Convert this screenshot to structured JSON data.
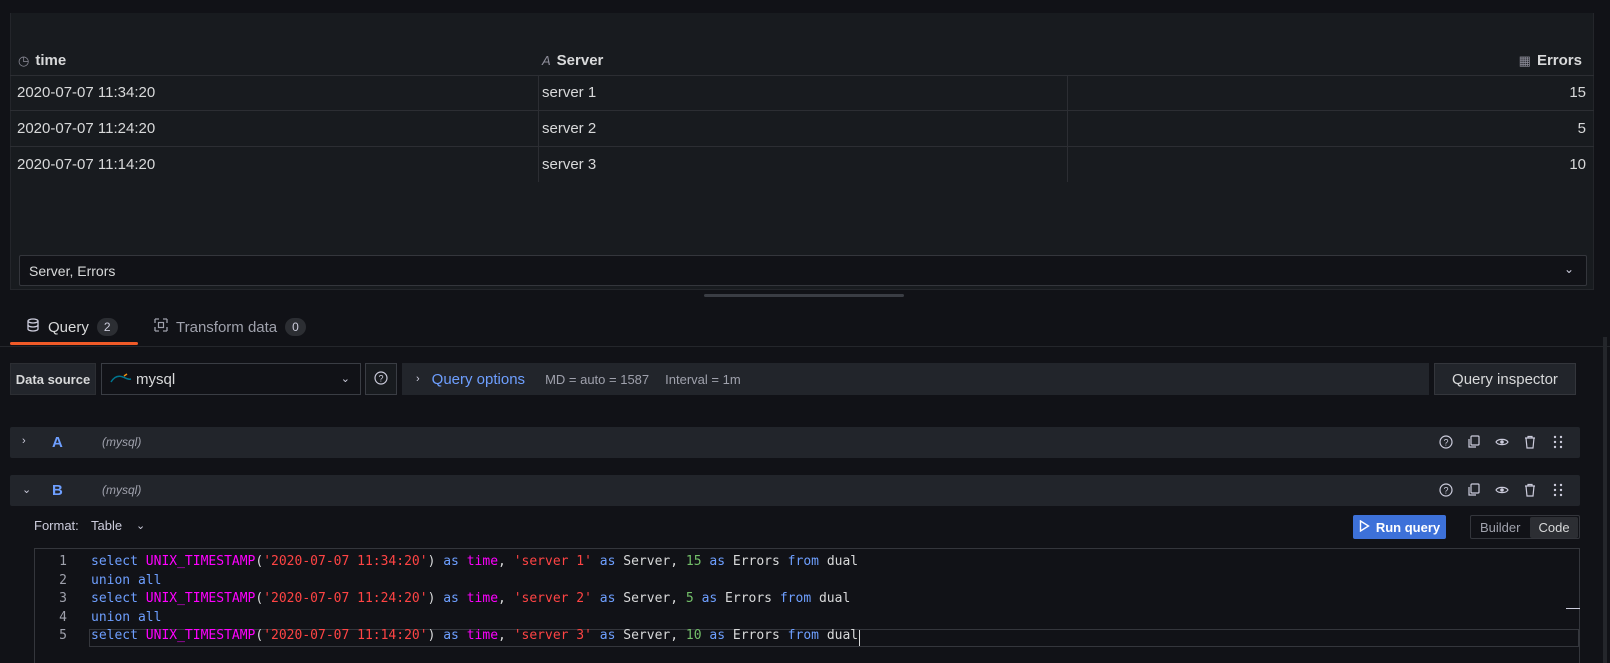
{
  "table": {
    "columns": [
      {
        "label": "time",
        "icon": "clock-icon"
      },
      {
        "label": "Server",
        "icon": "text-icon"
      },
      {
        "label": "Errors",
        "icon": "number-icon"
      }
    ],
    "rows": [
      {
        "time": "2020-07-07 11:34:20",
        "server": "server 1",
        "errors": "15"
      },
      {
        "time": "2020-07-07 11:24:20",
        "server": "server 2",
        "errors": "5"
      },
      {
        "time": "2020-07-07 11:14:20",
        "server": "server 3",
        "errors": "10"
      }
    ],
    "frame_select": "Server, Errors"
  },
  "tabs": [
    {
      "label": "Query",
      "count": "2",
      "active": true
    },
    {
      "label": "Transform data",
      "count": "0",
      "active": false
    }
  ],
  "datasource": {
    "label": "Data source",
    "value": "mysql",
    "query_options": "Query options",
    "md": "MD = auto = 1587",
    "interval": "Interval = 1m",
    "inspector": "Query inspector"
  },
  "queries": [
    {
      "ref": "A",
      "ds": "(mysql)",
      "expanded": false
    },
    {
      "ref": "B",
      "ds": "(mysql)",
      "expanded": true
    }
  ],
  "editor": {
    "format_label": "Format:",
    "format_value": "Table",
    "run_label": "Run query",
    "mode_builder": "Builder",
    "mode_code": "Code",
    "lines": [
      "select UNIX_TIMESTAMP('2020-07-07 11:34:20') as time, 'server 1' as Server, 15 as Errors from dual",
      "union all",
      "select UNIX_TIMESTAMP('2020-07-07 11:24:20') as time, 'server 2' as Server, 5 as Errors from dual",
      "union all",
      "select UNIX_TIMESTAMP('2020-07-07 11:14:20') as time, 'server 3' as Server, 10 as Errors from dual"
    ]
  },
  "colors": {
    "accent": "#6e9fff",
    "tab_active": "#f05a28",
    "primary_button": "#3d71d9"
  }
}
